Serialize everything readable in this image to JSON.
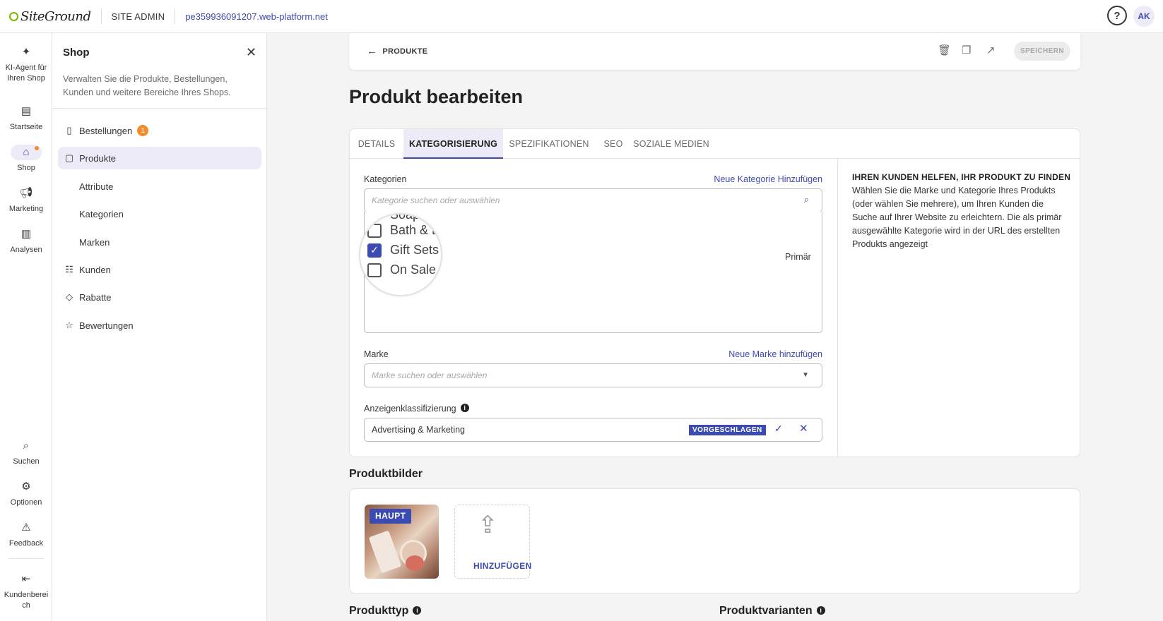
{
  "topbar": {
    "logo_text": "SiteGround",
    "site_admin": "SITE ADMIN",
    "domain": "pe359936091207.web-platform.net",
    "help": "?",
    "avatar": "AK"
  },
  "rail": {
    "items": [
      {
        "label": "KI-Agent für Ihren Shop",
        "icon": "sparkle-icon"
      },
      {
        "label": "Startseite",
        "icon": "dashboard-icon"
      },
      {
        "label": "Shop",
        "icon": "store-icon"
      },
      {
        "label": "Marketing",
        "icon": "megaphone-icon"
      },
      {
        "label": "Analysen",
        "icon": "chart-icon"
      },
      {
        "label": "Suchen",
        "icon": "search-icon"
      },
      {
        "label": "Optionen",
        "icon": "gear-icon"
      },
      {
        "label": "Feedback",
        "icon": "feedback-icon"
      },
      {
        "label": "Kundenbereich",
        "icon": "exit-icon"
      }
    ]
  },
  "panel": {
    "title": "Shop",
    "description": "Verwalten Sie die Produkte, Bestellungen, Kunden und weitere Bereiche Ihres Shops.",
    "nav": [
      {
        "label": "Bestellungen",
        "badge": "1"
      },
      {
        "label": "Produkte"
      },
      {
        "label": "Attribute"
      },
      {
        "label": "Kategorien"
      },
      {
        "label": "Marken"
      },
      {
        "label": "Kunden"
      },
      {
        "label": "Rabatte"
      },
      {
        "label": "Bewertungen"
      }
    ]
  },
  "actionbar": {
    "back_label": "PRODUKTE",
    "save_label": "SPEICHERN"
  },
  "page": {
    "title": "Produkt bearbeiten"
  },
  "tabs": [
    "DETAILS",
    "KATEGORISIERUNG",
    "SPEZIFIKATIONEN",
    "SEO",
    "SOZIALE MEDIEN"
  ],
  "categorization": {
    "categories_label": "Kategorien",
    "new_category_link": "Neue Kategorie Hinzufügen",
    "category_placeholder": "Kategorie suchen oder auswählen",
    "category_items": [
      {
        "label": "Soap",
        "checked": false
      },
      {
        "label": "Bath & B",
        "checked": false
      },
      {
        "label": "Gift Sets",
        "checked": true
      },
      {
        "label": "On Sale",
        "checked": false
      }
    ],
    "primary_label": "Primär",
    "brand_label": "Marke",
    "new_brand_link": "Neue Marke hinzufügen",
    "brand_placeholder": "Marke suchen oder auswählen",
    "ad_label": "Anzeigenklassifizierung",
    "ad_value": "Advertising & Marketing",
    "ad_suggested": "VORGESCHLAGEN"
  },
  "help_box": {
    "title": "IHREN KUNDEN HELFEN, IHR PRODUKT ZU FINDEN",
    "text": "Wählen Sie die Marke und Kategorie Ihres Produkts (oder wählen Sie mehrere), um Ihren Kunden die Suche auf Ihrer Website zu erleichtern. Die als primär ausgewählte Kategorie wird in der URL des erstellten Produkts angezeigt"
  },
  "images": {
    "title": "Produktbilder",
    "main_badge": "HAUPT",
    "add_label": "HINZUFÜGEN"
  },
  "bottom_sections": {
    "product_type": "Produkttyp",
    "product_variants": "Produktvarianten"
  },
  "colors": {
    "accent": "#3c4bb1",
    "accent_light": "#ecebf7",
    "badge_orange": "#f28d2c"
  }
}
